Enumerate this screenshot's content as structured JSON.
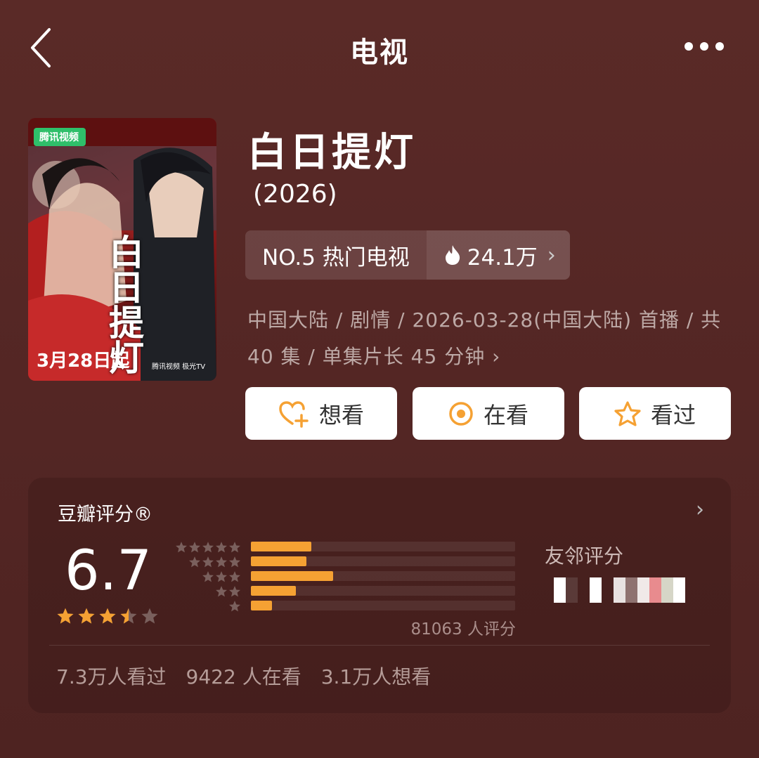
{
  "header": {
    "title": "电视"
  },
  "poster": {
    "platform_logo": "腾讯视频",
    "title_text": "白日提灯",
    "date_text": "3月28日起",
    "platform_text": "腾讯视频 极光TV"
  },
  "show": {
    "title": "白日提灯",
    "year": "(2026)",
    "rank_label": "NO.5 热门电视",
    "heat": "24.1万",
    "meta_line1": "中国大陆 / 剧情 / 2026-03-28(中国大陆) 首播 / 共",
    "meta_line2": "40 集 / 单集片长 45 分钟"
  },
  "actions": {
    "want": "想看",
    "watching": "在看",
    "watched": "看过"
  },
  "rating": {
    "title": "豆瓣评分®",
    "score": "6.7",
    "stars": 3.5,
    "distribution": [
      0.23,
      0.21,
      0.31,
      0.17,
      0.08
    ],
    "count_text": "81063 人评分",
    "friends_title": "友邻评分"
  },
  "stats": {
    "watched": "7.3万人看过",
    "watching": "9422 人在看",
    "want": "3.1万人想看"
  },
  "colors": {
    "background": "#552725",
    "accent": "#f5a133",
    "text_muted": "#bda9a6"
  }
}
